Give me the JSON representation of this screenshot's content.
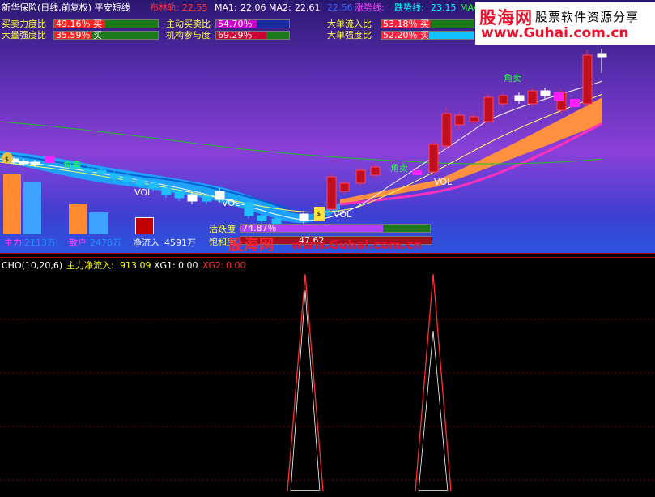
{
  "header": {
    "title": "新华保险(日线,前复权) 平安短线",
    "boll_label": "布林轨:",
    "boll_value": "22.55",
    "ma1_label": "MA1:",
    "ma1_value": "22.06",
    "ma2_label": "MA2:",
    "ma2_value": "22.61",
    "mid_value": "22.56",
    "up_label": "涨势线:",
    "up_value": "",
    "down_label": "跌势线:",
    "down_value": "23.15",
    "ma_tail": "MA4"
  },
  "watermark": {
    "brand": "股海网",
    "slogan": "股票软件资源分享",
    "url": "www.Guhai.com.cn",
    "url2": "www.Guhai.com.cn",
    "brand2": "股海网"
  },
  "indicators": [
    {
      "label": "买卖力度比",
      "value": "49.16％ 买",
      "fraction": 0.49,
      "color": "#ff2020",
      "rest": "#1a7a1a"
    },
    {
      "label": "大量强度比",
      "value": "35.59％ 买",
      "fraction": 0.36,
      "color": "#ff2020",
      "rest": "#1a7a1a"
    },
    {
      "label": "主动买卖比",
      "value": "54.70％",
      "fraction": 0.55,
      "color": "#cc00cc",
      "rest": "#1a2aa0"
    },
    {
      "label": "机构参与度",
      "value": "69.29％",
      "fraction": 0.69,
      "color": "#cc0033",
      "rest": "#1a7a1a"
    },
    {
      "label": "大单流入比",
      "value": "53.18％ 买",
      "fraction": 0.53,
      "color": "#ff2040",
      "rest": "#1a7a1a"
    },
    {
      "label": "大单强度比",
      "value": "52.20％ 买",
      "fraction": 0.52,
      "color": "#ff2040",
      "rest": "#10c0ff"
    }
  ],
  "volume_boxes": [
    {
      "label": "主力",
      "value": "2113万",
      "color": "#2090ff"
    },
    {
      "label": "散户",
      "value": "2478万",
      "color": "#2090ff"
    },
    {
      "label": "净流入",
      "value": "4591万",
      "color": "#fff"
    }
  ],
  "activity": {
    "active_label": "活跃度",
    "active_value": "74.87％",
    "active_fraction": 0.75,
    "sat_label": "饱和度",
    "sat_value": "47.62",
    "sat_fraction": 0.48
  },
  "chart_labels": {
    "vol": "VOL",
    "jiaomai": "角卖",
    "jiaomai2": "角卖",
    "jiaomai3": "角卖"
  },
  "cho": {
    "name": "CHO(10,20,6)",
    "main_label": "主力净流入:",
    "main_value": "913.09",
    "xg1_label": "XG1:",
    "xg1_value": "0.00",
    "xg2_label": "XG2:",
    "xg2_value": "0.00"
  },
  "colors": {
    "header_yellow": "#ffff00",
    "red": "#ff3030",
    "cyan": "#00ffff",
    "grid": "#7a0000"
  }
}
